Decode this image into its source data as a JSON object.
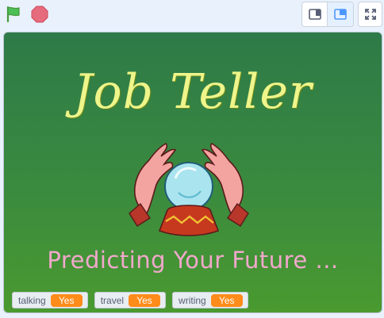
{
  "toolbar": {
    "green_flag_icon": "green-flag-icon",
    "stop_icon": "stop-sign-icon",
    "small_stage_icon": "small-stage-icon",
    "normal_stage_icon": "normal-stage-icon",
    "fullscreen_icon": "fullscreen-icon",
    "colors": {
      "flag": "#4cbf56",
      "stop": "#ec5959",
      "accent": "#4c97ff"
    }
  },
  "stage": {
    "title": "Job Teller",
    "subtitle": "Predicting Your Future ...",
    "monitors": [
      {
        "label": "talking",
        "value": "Yes"
      },
      {
        "label": "travel",
        "value": "Yes"
      },
      {
        "label": "writing",
        "value": "Yes"
      }
    ]
  }
}
